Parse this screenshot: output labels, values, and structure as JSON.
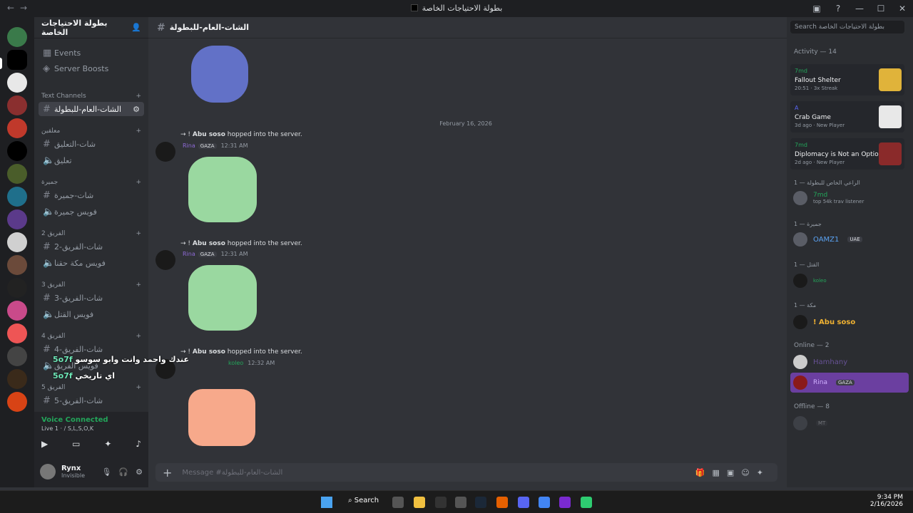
{
  "window": {
    "title": "بطولة الاحتياجات الخاصة"
  },
  "guild": {
    "name": "بطولة الاحتياجات الخاصة"
  },
  "channels": {
    "events": "Events",
    "boosts": "Server Boosts",
    "text_category": "Text Channels",
    "active_channel": "الشات-العام-للبطولة",
    "cat1": "معلقين",
    "ch1": "شات-التعليق",
    "ch2": "تعليق",
    "cat2": "جميرة",
    "ch3": "شات-جميرة",
    "ch4": "فويس جميرة",
    "cat3": "الفريق 2",
    "ch5": "شات-الفريق-2",
    "ch6": "فويس مكة حقنا",
    "cat4": "الفريق 3",
    "ch7": "شات-الفريق-3",
    "ch8": "فويس القتل",
    "cat5": "الفريق 4",
    "ch9": "شات-الفريق-4",
    "ch10": "فويس الفريق",
    "cat6": "الفريق 5",
    "ch11": "شات-الفريق-5"
  },
  "voice": {
    "status": "Voice Connected",
    "detail": "Live 1 · / S,L,S,O,K"
  },
  "user": {
    "name": "Rynx",
    "status": "Invisible"
  },
  "chat": {
    "channel_title": "الشات-العام-للبطولة",
    "date_divider": "February 16, 2026",
    "join_text": "hopped into the server.",
    "joiner": "Abu soso",
    "msg1": {
      "name": "Rina",
      "tag": "GAZA",
      "time": "12:31 AM"
    },
    "msg2": {
      "name": "Rina",
      "tag": "GAZA",
      "time": "12:31 AM"
    },
    "msg3": {
      "name": "koleo",
      "time": "12:32 AM"
    },
    "placeholder": "Message #الشات-العام-للبطولة"
  },
  "overlay": {
    "line1_user": "5o7f",
    "line1_text": "عندك واحمد وانت وابو سوسو",
    "line2_user": "5o7f",
    "line2_text": "اي تاريخي"
  },
  "search": {
    "placeholder": "Search بطولة الاحتياجات الخاصة"
  },
  "members": {
    "activity_header": "Activity — 14",
    "activities": [
      {
        "user": "7md",
        "game": "Fallout Shelter",
        "meta": "20:51 · 3x Streak"
      },
      {
        "user": "A",
        "game": "Crab Game",
        "meta": "3d ago · New Player"
      },
      {
        "user": "7md",
        "game": "Diplomacy is Not an Optio...",
        "meta": "2d ago · New Player"
      }
    ],
    "role1": "الراعي الخاص للبطولة — 1",
    "role1_member": "7md",
    "role1_sub": "top 54k trav listener",
    "role2": "جميرة — 1",
    "role2_member": "OAMZ1",
    "role2_tag": "UAE",
    "role3": "القتل — 1",
    "role3_member": "koleo",
    "role4": "مكة — 1",
    "role4_member": "! Abu soso",
    "online_header": "Online — 2",
    "online1": "Hamhany",
    "online2": "Rina",
    "online2_tag": "GAZA",
    "offline_header": "Offline — 8",
    "offline1": "MT"
  },
  "taskbar": {
    "search": "Search",
    "time": "9:34 PM",
    "date": "2/16/2026"
  }
}
